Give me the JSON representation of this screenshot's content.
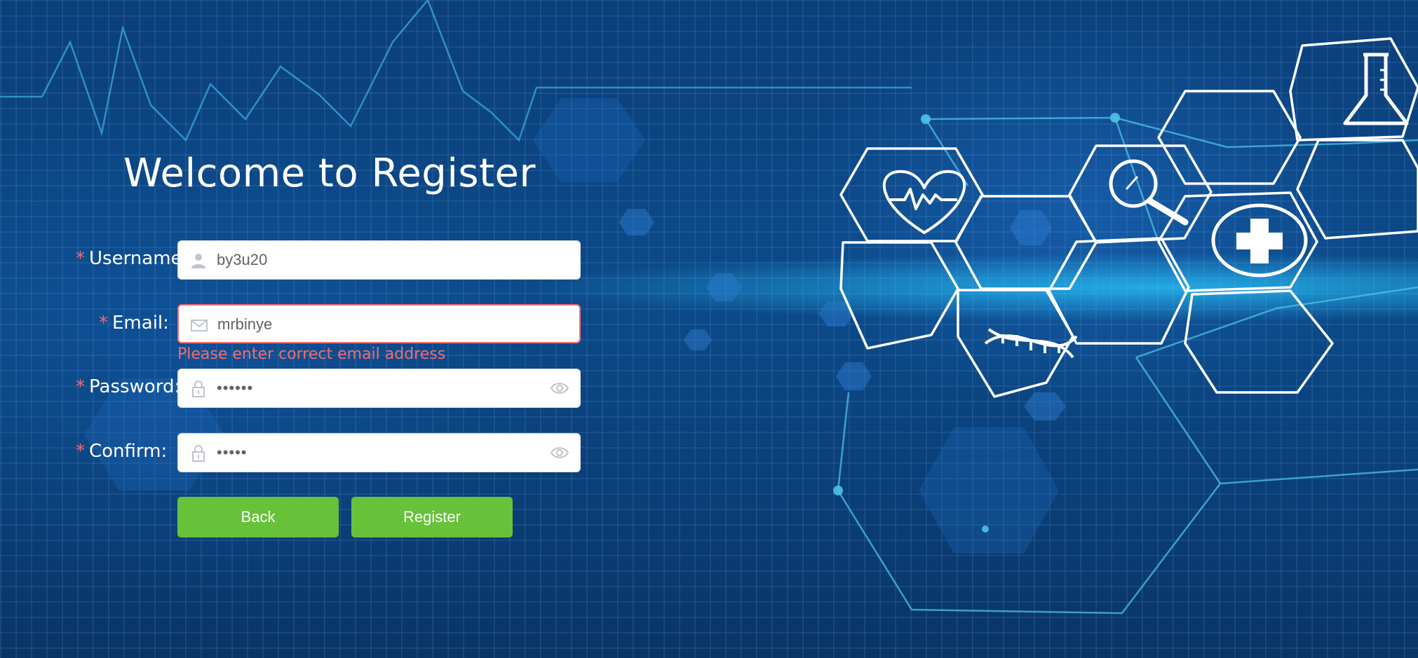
{
  "page": {
    "title": "Welcome to Register"
  },
  "form": {
    "username": {
      "label": "Username:",
      "value": "by3u20",
      "icon": "user-icon"
    },
    "email": {
      "label": "Email:",
      "value": "mrbinye",
      "icon": "mail-icon",
      "error": "Please enter correct email address"
    },
    "password": {
      "label": "Password:",
      "value": "••••••",
      "icon": "lock-icon",
      "toggle_icon": "eye-icon"
    },
    "confirm": {
      "label": "Confirm:",
      "value": "•••••",
      "icon": "lock-icon",
      "toggle_icon": "eye-icon"
    },
    "required_mark": "*"
  },
  "buttons": {
    "back": "Back",
    "register": "Register"
  },
  "colors": {
    "accent_green": "#67c23a",
    "error_red": "#f56c6c",
    "background_blue": "#0c4a8a"
  }
}
